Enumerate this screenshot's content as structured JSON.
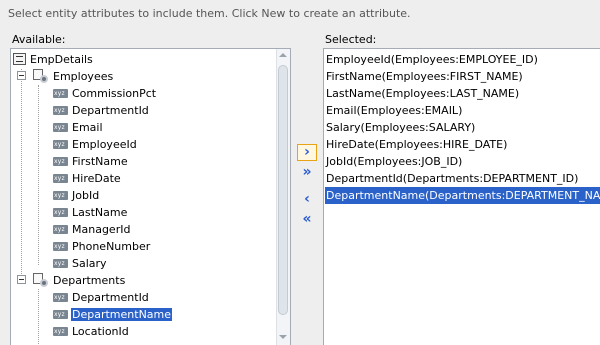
{
  "instructions": "Select entity attributes to include them.  Click New to create an attribute.",
  "available": {
    "label": "Available:",
    "root": "EmpDetails",
    "groups": [
      {
        "name": "Employees",
        "attributes": [
          "CommissionPct",
          "DepartmentId",
          "Email",
          "EmployeeId",
          "FirstName",
          "HireDate",
          "JobId",
          "LastName",
          "ManagerId",
          "PhoneNumber",
          "Salary"
        ]
      },
      {
        "name": "Departments",
        "attributes": [
          "DepartmentId",
          "DepartmentName",
          "LocationId"
        ]
      }
    ],
    "selected_item": "DepartmentName"
  },
  "shuttle": {
    "move_right": "›",
    "move_all_right": "»",
    "move_left": "‹",
    "move_all_left": "«"
  },
  "selected": {
    "label": "Selected:",
    "items": [
      "EmployeeId(Employees:EMPLOYEE_ID)",
      "FirstName(Employees:FIRST_NAME)",
      "LastName(Employees:LAST_NAME)",
      "Email(Employees:EMAIL)",
      "Salary(Employees:SALARY)",
      "HireDate(Employees:HIRE_DATE)",
      "JobId(Employees:JOB_ID)",
      "DepartmentId(Departments:DEPARTMENT_ID)",
      "DepartmentName(Departments:DEPARTMENT_NAME)"
    ],
    "selected_index": 8
  },
  "colors": {
    "selection": "#2a62c9",
    "shuttle_arrow": "#2a5bd1",
    "focus_border": "#e8a317"
  }
}
